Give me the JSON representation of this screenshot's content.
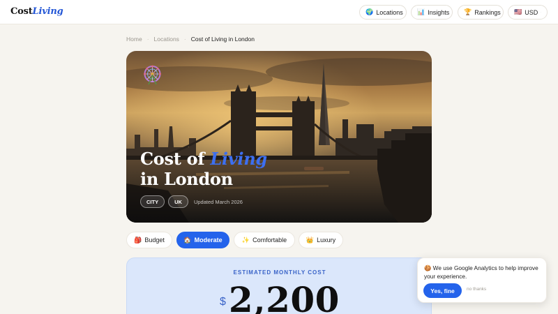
{
  "header": {
    "logo_main": "Cost",
    "logo_accent": "Living",
    "nav": [
      {
        "icon": "globe-icon",
        "glyph": "🌍",
        "label": "Locations"
      },
      {
        "icon": "chart-icon",
        "glyph": "📊",
        "label": "Insights"
      },
      {
        "icon": "trophy-icon",
        "glyph": "🏆",
        "label": "Rankings"
      }
    ],
    "currency": {
      "flag": "🇺🇸",
      "label": "USD"
    }
  },
  "breadcrumb": [
    "Home",
    "Locations",
    "Cost of Living in London"
  ],
  "hero": {
    "title_prefix": "Cost of",
    "title_accent": "Living",
    "title_line2": "in London",
    "tags": [
      "CITY",
      "UK"
    ],
    "updated": "Updated March 2026",
    "badge_icon": "ferris-wheel-icon"
  },
  "tiers": [
    {
      "icon": "backpack-icon",
      "glyph": "🎒",
      "label": "Budget",
      "active": false
    },
    {
      "icon": "house-icon",
      "glyph": "🏠",
      "label": "Moderate",
      "active": true
    },
    {
      "icon": "sparkles-icon",
      "glyph": "✨",
      "label": "Comfortable",
      "active": false
    },
    {
      "icon": "crown-icon",
      "glyph": "👑",
      "label": "Luxury",
      "active": false
    }
  ],
  "estimate": {
    "label": "ESTIMATED MONTHLY COST",
    "currency_symbol": "$",
    "value": "2,200"
  },
  "cookie": {
    "glyph": "🍪",
    "text": "We use Google Analytics to help improve your experience.",
    "accept": "Yes, fine",
    "decline": "no thanks"
  },
  "colors": {
    "accent": "#2463eb",
    "background": "#f6f4ef",
    "estimate_bg": "#dbe7fb"
  }
}
